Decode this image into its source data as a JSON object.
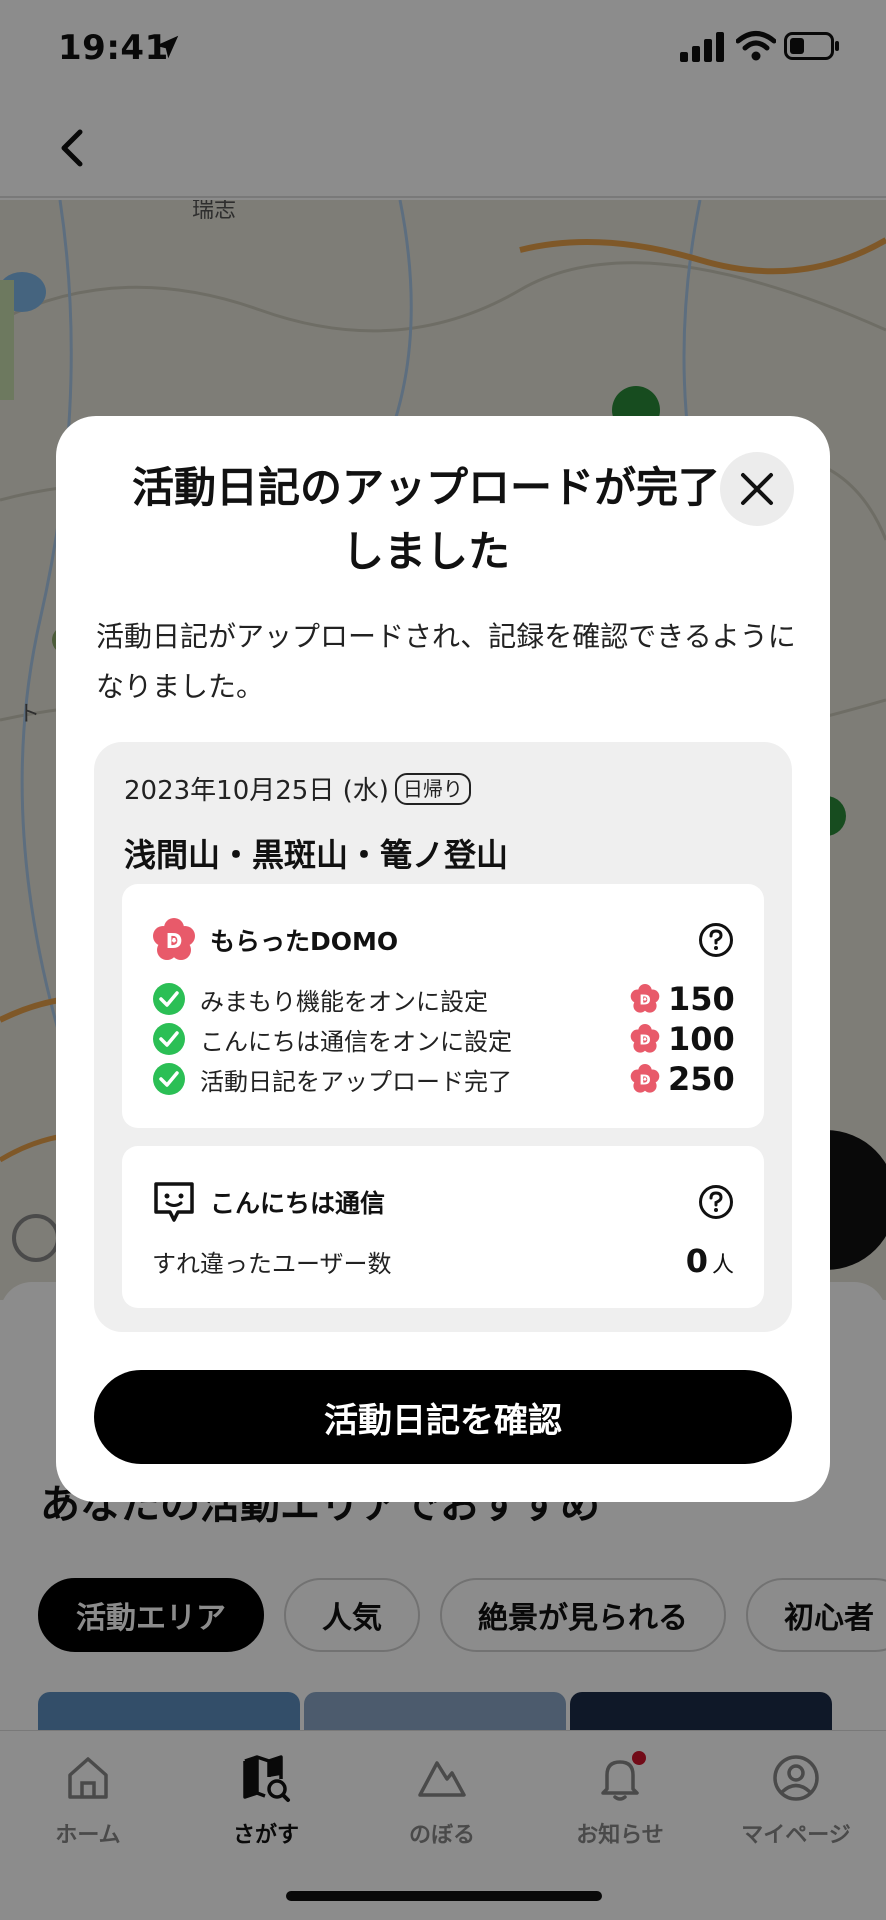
{
  "status": {
    "time": "19:41"
  },
  "map": {
    "labels": [
      "瑞志",
      "ト"
    ]
  },
  "section": {
    "title": "あなたの活動エリアでおすすめ"
  },
  "chips": [
    {
      "label": "活動エリア"
    },
    {
      "label": "人気"
    },
    {
      "label": "絶景が見られる"
    },
    {
      "label": "初心者"
    }
  ],
  "tabs": [
    {
      "label": "ホーム",
      "icon": "home-icon"
    },
    {
      "label": "さがす",
      "icon": "map-search-icon"
    },
    {
      "label": "のぼる",
      "icon": "mountain-icon"
    },
    {
      "label": "お知らせ",
      "icon": "bell-icon"
    },
    {
      "label": "マイページ",
      "icon": "person-icon"
    }
  ],
  "modal": {
    "title": "活動日記のアップロードが完了しました",
    "description": "活動日記がアップロードされ、記録を確認できるようになりました。",
    "summary": {
      "date": "2023年10月25日 (水)",
      "badge": "日帰り",
      "mountain": "浅間山・黒斑山・篭ノ登山"
    },
    "domo": {
      "title": "もらったDOMO",
      "rows": [
        {
          "label": "みまもり機能をオンに設定",
          "points": "150"
        },
        {
          "label": "こんにちは通信をオンに設定",
          "points": "100"
        },
        {
          "label": "活動日記をアップロード完了",
          "points": "250"
        }
      ]
    },
    "hello": {
      "title": "こんにちは通信",
      "label": "すれ違ったユーザー数",
      "value": "0",
      "unit": "人"
    },
    "button": "活動日記を確認"
  },
  "colors": {
    "accent": "#e85a6a",
    "check": "#2bbf55",
    "primary": "#000000"
  }
}
